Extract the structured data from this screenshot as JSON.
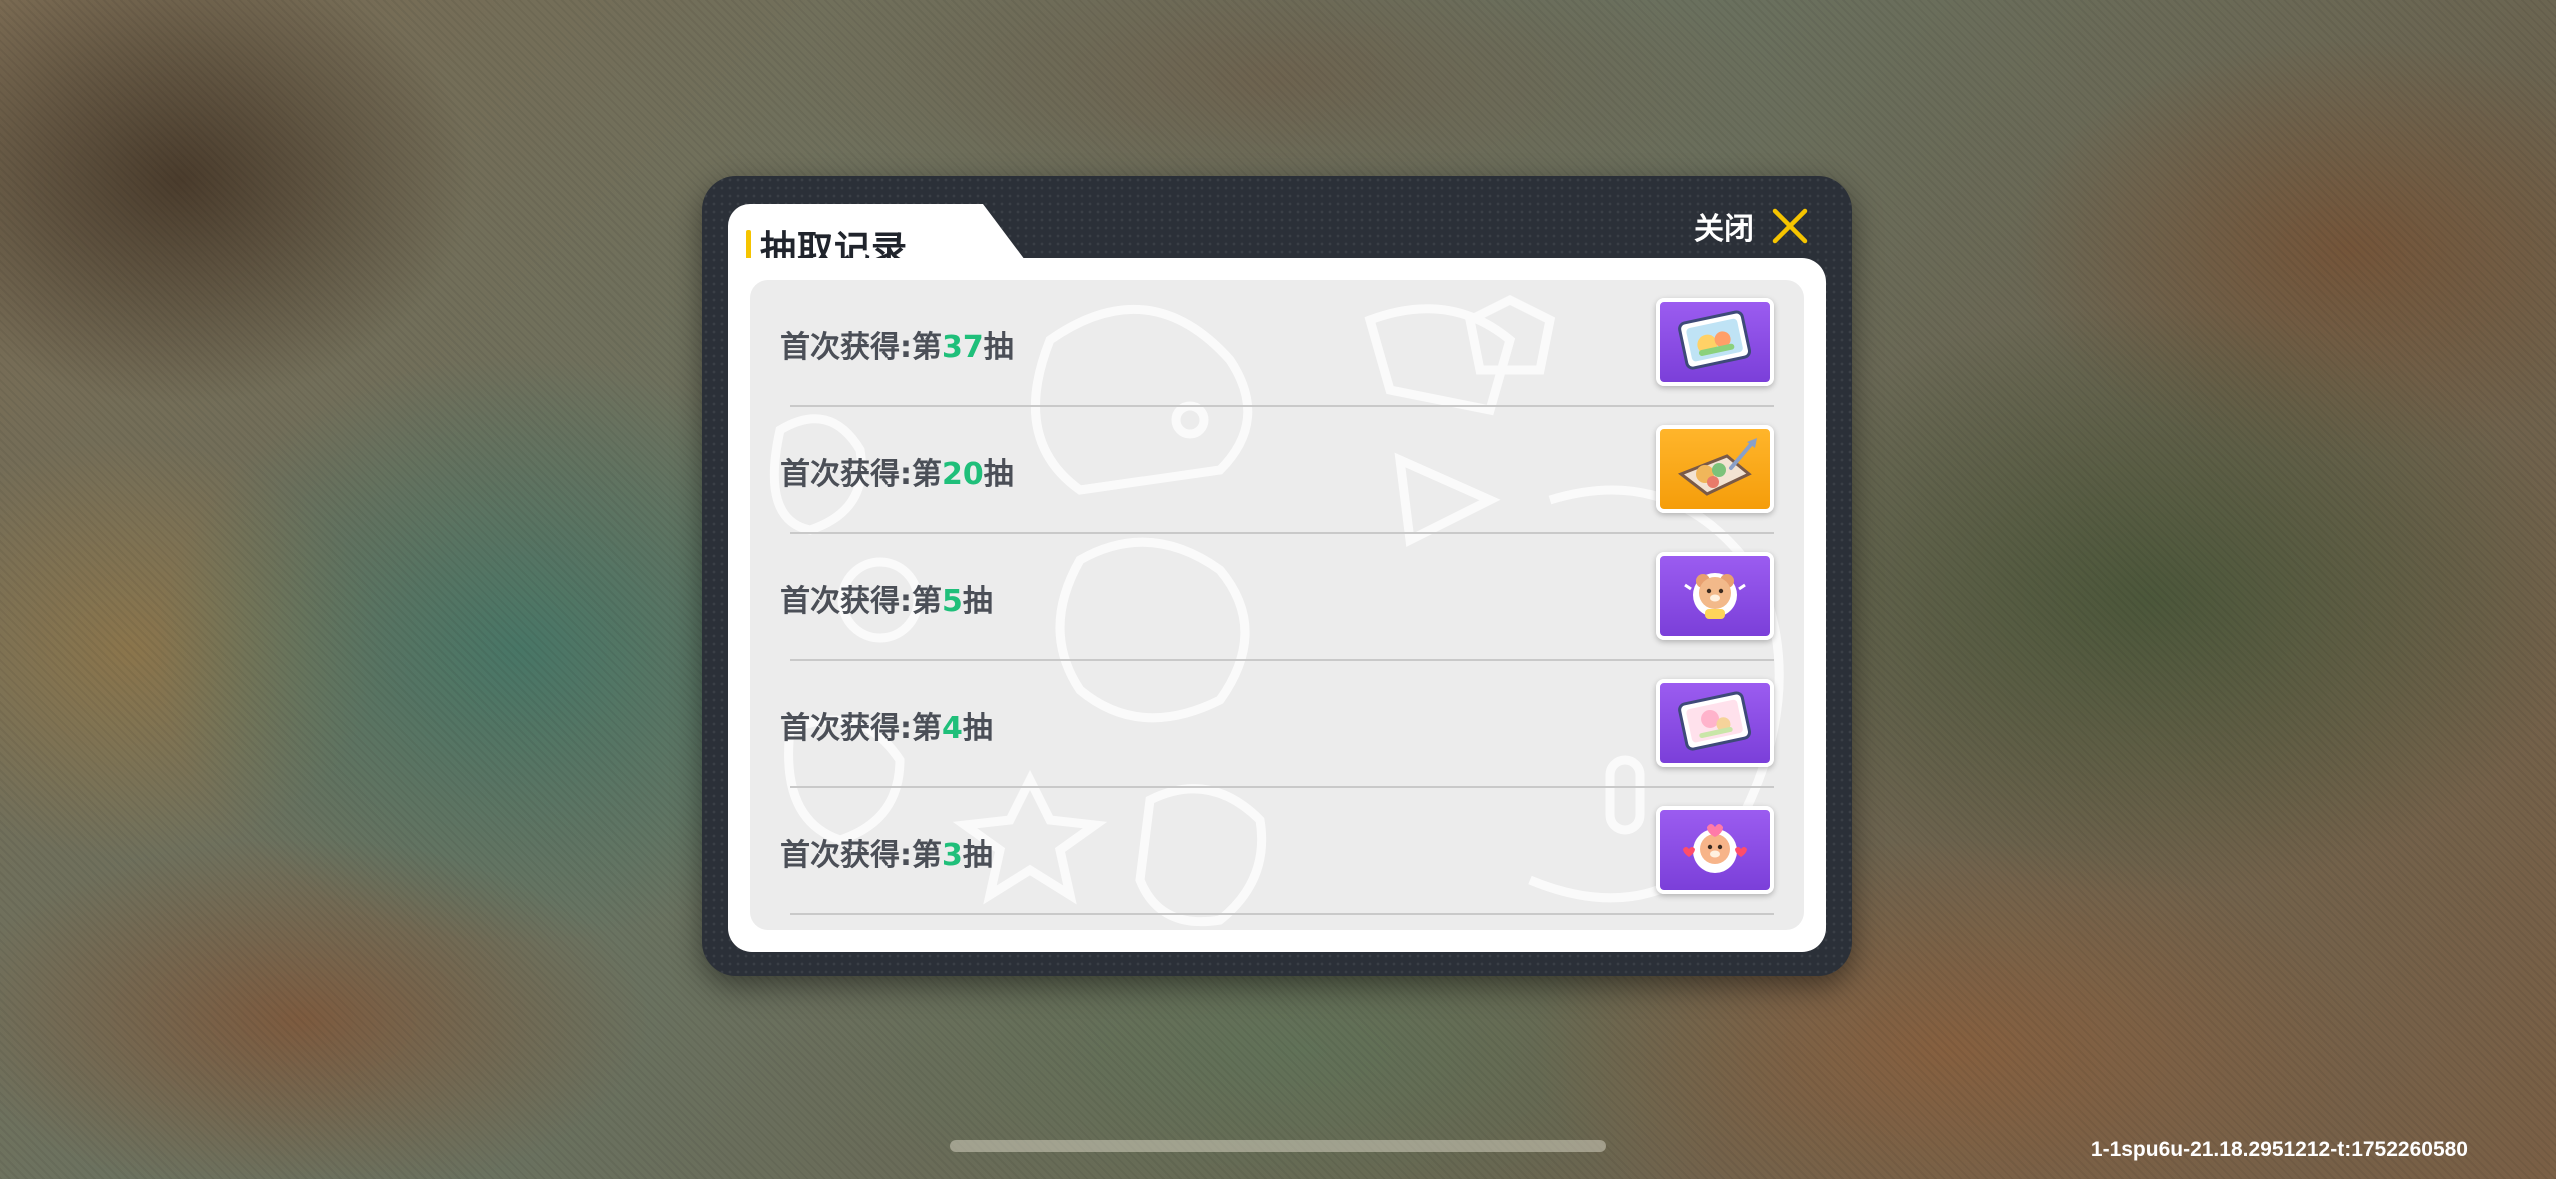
{
  "dialog": {
    "title": "抽取记录",
    "close_label": "关闭",
    "close_icon": "close-x-icon",
    "accent_color": "#f5c400"
  },
  "records": [
    {
      "prefix": "首次获得:第",
      "number": "37",
      "suffix": "抽",
      "item_rarity": "purple",
      "item_icon": "food-card-icon"
    },
    {
      "prefix": "首次获得:第",
      "number": "20",
      "suffix": "抽",
      "item_rarity": "orange",
      "item_icon": "food-platter-icon"
    },
    {
      "prefix": "首次获得:第",
      "number": "5",
      "suffix": "抽",
      "item_rarity": "purple",
      "item_icon": "bear-sticker-icon"
    },
    {
      "prefix": "首次获得:第",
      "number": "4",
      "suffix": "抽",
      "item_rarity": "purple",
      "item_icon": "pink-card-icon"
    },
    {
      "prefix": "首次获得:第",
      "number": "3",
      "suffix": "抽",
      "item_rarity": "purple",
      "item_icon": "heart-bear-sticker-icon"
    }
  ],
  "footer": {
    "version": "1-1spu6u-21.18.2951212-t:1752260580"
  },
  "colors": {
    "number_highlight": "#1fbf7a",
    "rarity_purple": "#8a4ee6",
    "rarity_orange": "#f9a816"
  }
}
